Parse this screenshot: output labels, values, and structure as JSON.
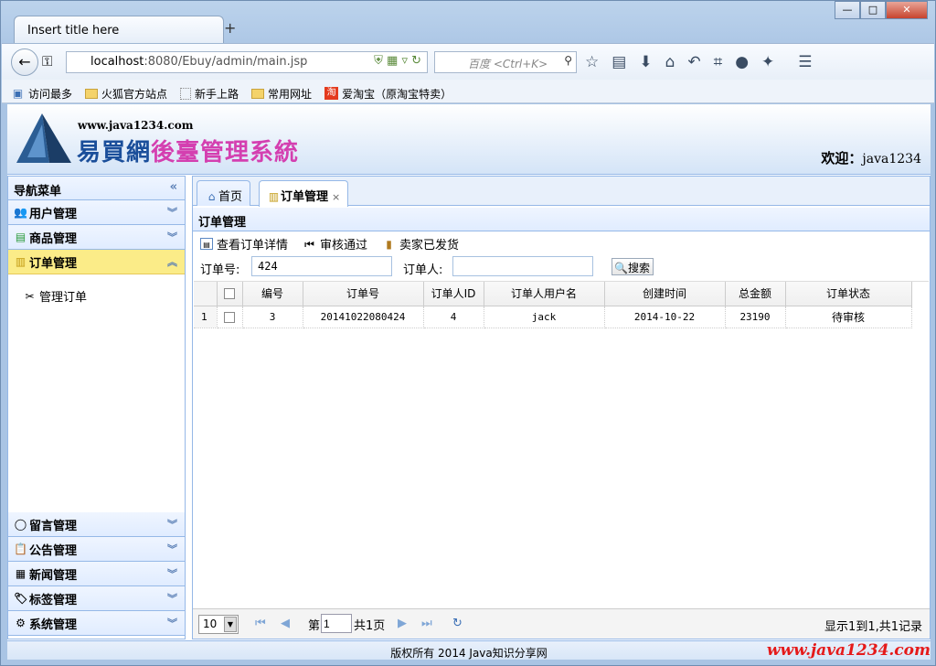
{
  "browser": {
    "tab_title": "Insert title here",
    "new_tab": "+",
    "url_host": "localhost",
    "url_rest": ":8080/Ebuy/admin/main.jsp",
    "search_placeholder": "百度 <Ctrl+K>",
    "window_controls": [
      "minimize-icon",
      "maximize-icon",
      "close-icon"
    ]
  },
  "bookmarks": [
    {
      "label": "访问最多",
      "icon": "page-icon"
    },
    {
      "label": "火狐官方站点",
      "icon": "folder-icon"
    },
    {
      "label": "新手上路",
      "icon": "blank-page-icon"
    },
    {
      "label": "常用网址",
      "icon": "folder-icon"
    },
    {
      "label": "爱淘宝（原淘宝特卖）",
      "icon": "taobao-icon"
    }
  ],
  "header": {
    "site": "www.java1234.com",
    "title_blue": "易買網",
    "title_pink": "後臺管理系統",
    "welcome_label": "欢迎：",
    "welcome_user": "java1234"
  },
  "sidebar": {
    "title": "导航菜单",
    "sections": [
      {
        "label": "用户管理"
      },
      {
        "label": "商品管理"
      },
      {
        "label": "订单管理"
      },
      {
        "label": "留言管理"
      },
      {
        "label": "公告管理"
      },
      {
        "label": "新闻管理"
      },
      {
        "label": "标签管理"
      },
      {
        "label": "系统管理"
      }
    ],
    "order_items": [
      "管理订单"
    ]
  },
  "tabs": [
    {
      "label": "首页"
    },
    {
      "label": "订单管理",
      "close": "×"
    }
  ],
  "panel": {
    "title": "订单管理",
    "toolbar": [
      "查看订单详情",
      "审核通过",
      "卖家已发货"
    ],
    "order_no_label": "订单号:",
    "order_no_value": "424",
    "orderer_label": "订单人:",
    "orderer_value": "",
    "search_button": "搜索"
  },
  "grid": {
    "columns": [
      "编号",
      "订单号",
      "订单人ID",
      "订单人用户名",
      "创建时间",
      "总金额",
      "订单状态"
    ],
    "rows": [
      {
        "rownum": "1",
        "id": "3",
        "order_no": "20141022080424",
        "user_id": "4",
        "username": "jack",
        "created": "2014-10-22",
        "total": "23190",
        "status": "待审核"
      }
    ]
  },
  "pager": {
    "page_size": "10",
    "page_prefix": "第",
    "page_value": "1",
    "page_suffix": "共1页",
    "info": "显示1到1,共1记录"
  },
  "footer": {
    "text": "版权所有 2014 Java知识分享网",
    "watermark": "www.java1234.com"
  }
}
